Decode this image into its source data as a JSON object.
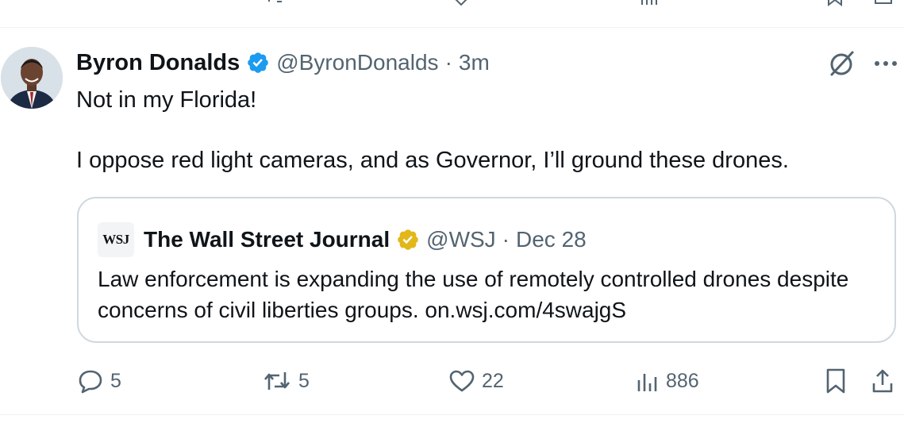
{
  "tweet": {
    "author": {
      "name": "Byron Donalds",
      "handle": "@ByronDonalds",
      "separator": "·",
      "time": "3m",
      "avatar_icon": "avatar-photo",
      "verified_icon": "blue-verified-badge-icon",
      "verified_color": "#1d9bf0"
    },
    "text_line1": "Not in my Florida!",
    "text_line2": "I oppose red light cameras, and as Governor, I’ll ground these drones.",
    "top_icons": [
      "grok-icon",
      "more-icon"
    ],
    "quoted": {
      "logo_text": "WSJ",
      "name": "The Wall Street Journal",
      "verified_icon": "gold-verified-badge-icon",
      "verified_color": "#e2b719",
      "handle": "@WSJ",
      "separator": "·",
      "date": "Dec 28",
      "text": "Law enforcement is expanding the use of remotely controlled drones despite concerns of civil liberties groups. on.wsj.com/4swajgS"
    },
    "actions": {
      "replies": "5",
      "reposts": "5",
      "likes": "22",
      "views": "886",
      "icons": [
        "reply-icon",
        "repost-icon",
        "like-icon",
        "views-icon",
        "bookmark-icon",
        "share-icon"
      ]
    }
  },
  "colors": {
    "text_primary": "#0f1419",
    "text_secondary": "#536471",
    "border": "#cfd9de",
    "separator": "#eff3f4"
  }
}
